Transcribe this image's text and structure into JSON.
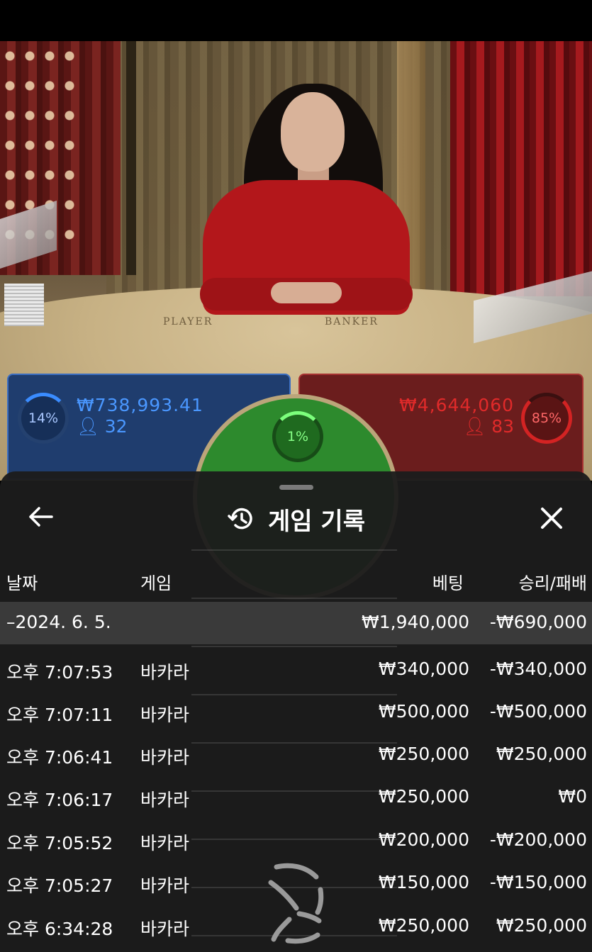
{
  "bets": {
    "player": {
      "percent": "14%",
      "amount": "₩738,993.41",
      "players": "32",
      "color": "#4a97ff"
    },
    "banker": {
      "percent": "85%",
      "amount": "₩4,644,060",
      "players": "83",
      "color": "#e02a2a"
    },
    "tie": {
      "percent": "1%",
      "color": "#2d8a2d"
    }
  },
  "table": {
    "player_label": "PLAYER",
    "banker_label": "BANKER"
  },
  "sheet": {
    "title": "게임 기록",
    "headers": {
      "date": "날짜",
      "game": "게임",
      "bet": "베팅",
      "result": "승리/패배"
    },
    "summary": {
      "date": "–2024. 6. 5.",
      "bet": "₩1,940,000",
      "result": "-₩690,000"
    },
    "rows": [
      {
        "time": "오후 7:07:53",
        "game": "바카라",
        "bet": "₩340,000",
        "result": "-₩340,000"
      },
      {
        "time": "오후 7:07:11",
        "game": "바카라",
        "bet": "₩500,000",
        "result": "-₩500,000"
      },
      {
        "time": "오후 7:06:41",
        "game": "바카라",
        "bet": "₩250,000",
        "result": "₩250,000"
      },
      {
        "time": "오후 7:06:17",
        "game": "바카라",
        "bet": "₩250,000",
        "result": "₩0"
      },
      {
        "time": "오후 7:05:52",
        "game": "바카라",
        "bet": "₩200,000",
        "result": "-₩200,000"
      },
      {
        "time": "오후 7:05:27",
        "game": "바카라",
        "bet": "₩150,000",
        "result": "-₩150,000"
      },
      {
        "time": "오후 6:34:28",
        "game": "바카라",
        "bet": "₩250,000",
        "result": "₩250,000"
      }
    ]
  },
  "icons": {
    "back": "arrow-left-icon",
    "history": "history-icon",
    "close": "close-icon",
    "loading": "loading-spinner-icon"
  }
}
